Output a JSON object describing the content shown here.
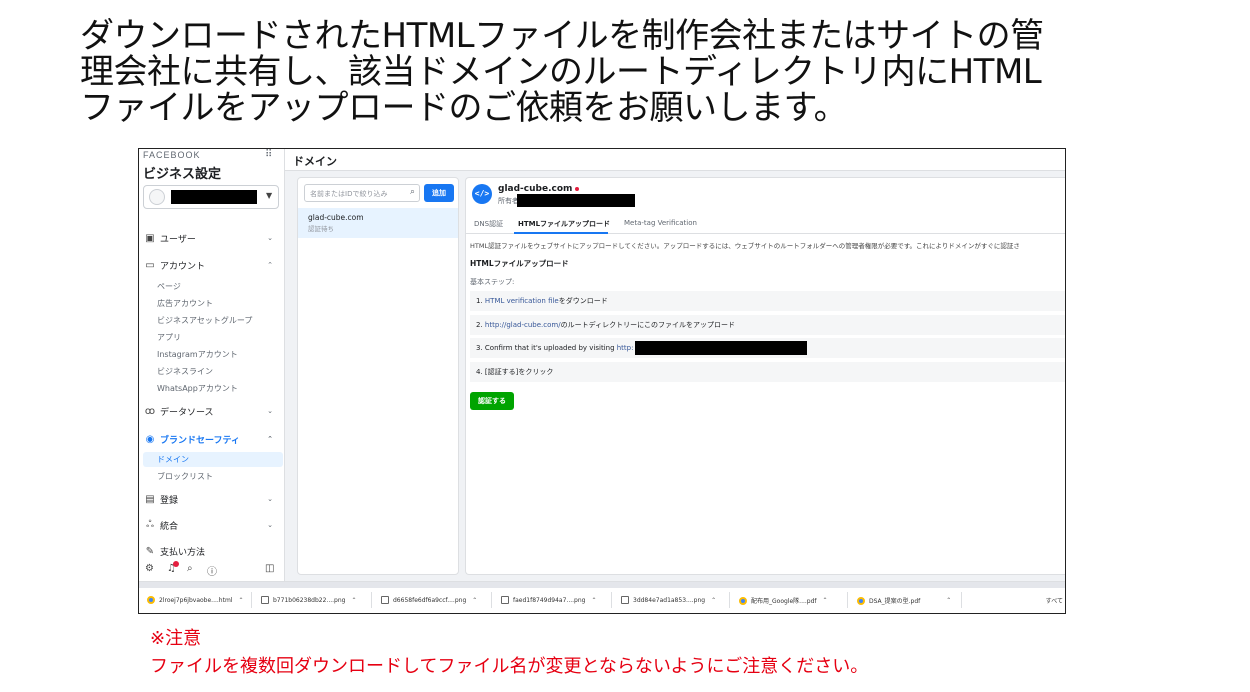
{
  "headline": {
    "line1": "ダウンロードされたHTMLファイルを制作会社またはサイトの管",
    "line2": "理会社に共有し、該当ドメインのルートディレクトリ内にHTML",
    "line3": "ファイルをアップロードのご依頼をお願いします。"
  },
  "sidebar": {
    "logo": "FACEBOOK",
    "title": "ビジネス設定",
    "nav": {
      "users": "ユーザー",
      "accounts": "アカウント",
      "data_sources": "データソース",
      "brand_safety": "ブランドセーフティ",
      "registrations": "登録",
      "integrations": "統合",
      "payments": "支払い方法"
    },
    "accounts_sub": [
      "ページ",
      "広告アカウント",
      "ビジネスアセットグループ",
      "アプリ",
      "Instagramアカウント",
      "ビジネスライン",
      "WhatsAppアカウント"
    ],
    "brand_sub": [
      "ドメイン",
      "ブロックリスト"
    ]
  },
  "header": {
    "title": "ドメイン"
  },
  "list": {
    "search_placeholder": "名前またはIDで絞り込み",
    "add_label": "追加",
    "item_name": "glad-cube.com",
    "item_status": "認証待ち"
  },
  "detail": {
    "domain": "glad-cube.com",
    "owner_label": "所有者:",
    "tabs": [
      "DNS認証",
      "HTMLファイルアップロード",
      "Meta-tag Verification"
    ],
    "description": "HTML認証ファイルをウェブサイトにアップロードしてください。アップロードするには、ウェブサイトのルートフォルダーへの管理者権限が必要です。これによりドメインがすぐに認証さ",
    "section_title": "HTMLファイルアップロード",
    "steps_label": "基本ステップ:",
    "step1_prefix": "1. ",
    "step1_link": "HTML verification file",
    "step1_suffix": "をダウンロード",
    "step2_prefix": "2. ",
    "step2_link": "http://glad-cube.com/",
    "step2_suffix": "のルートディレクトリーにこのファイルをアップロード",
    "step3_prefix": "3. Confirm that it's uploaded by visiting ",
    "step3_link": "http:",
    "step4": "4. [認証する]をクリック",
    "verify_label": "認証する"
  },
  "downloads": {
    "items": [
      "2lroej7p6jbvaobe....html",
      "b771b06238db22....png",
      "d6658fe6df6a9ccf....png",
      "faed1f8749d94a7....png",
      "3dd84e7ad1a853....png",
      "配布用_Google隊....pdf",
      "DSA_提案の型.pdf"
    ],
    "show_all": "すべて"
  },
  "note": {
    "head": "※注意",
    "body": "ファイルを複数回ダウンロードしてファイル名が変更とならないようにご注意ください。"
  }
}
